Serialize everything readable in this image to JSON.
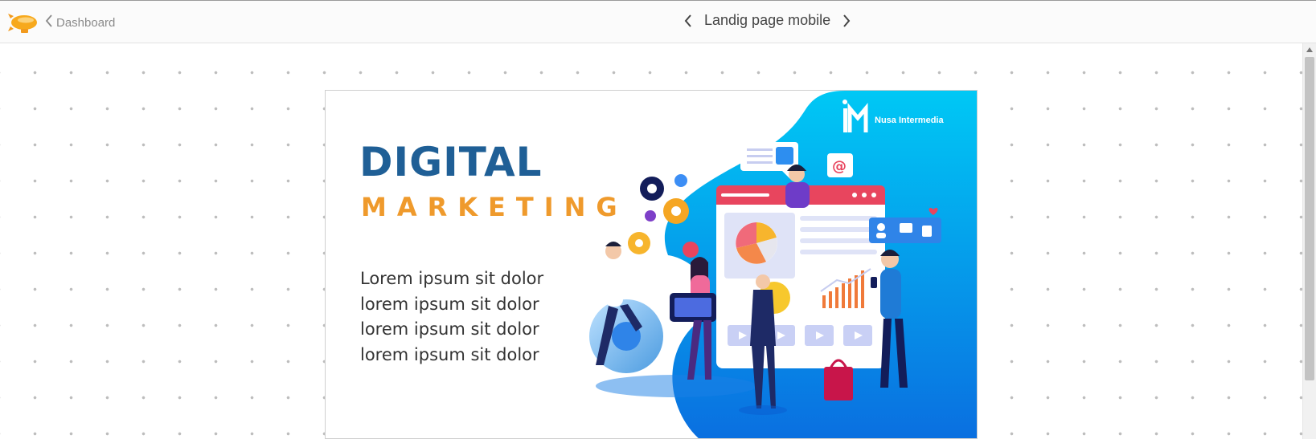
{
  "header": {
    "back_label": "Dashboard",
    "page_title": "Landig page mobile",
    "icons": {
      "logo": "blimp-logo-icon",
      "back": "chevron-left-icon",
      "prev": "chevron-left-icon",
      "next": "chevron-right-icon"
    }
  },
  "slide": {
    "heading_1": "DIGITAL",
    "heading_2": "MARKETING",
    "body_lines": [
      "Lorem ipsum sit dolor",
      "lorem ipsum sit dolor",
      "lorem ipsum sit dolor",
      "lorem ipsum sit dolor"
    ],
    "brand_name": "Nusa Intermedia",
    "colors": {
      "heading_1": "#1f5f96",
      "heading_2": "#ef9a2c",
      "illustration_bg": "#00bff0"
    }
  }
}
